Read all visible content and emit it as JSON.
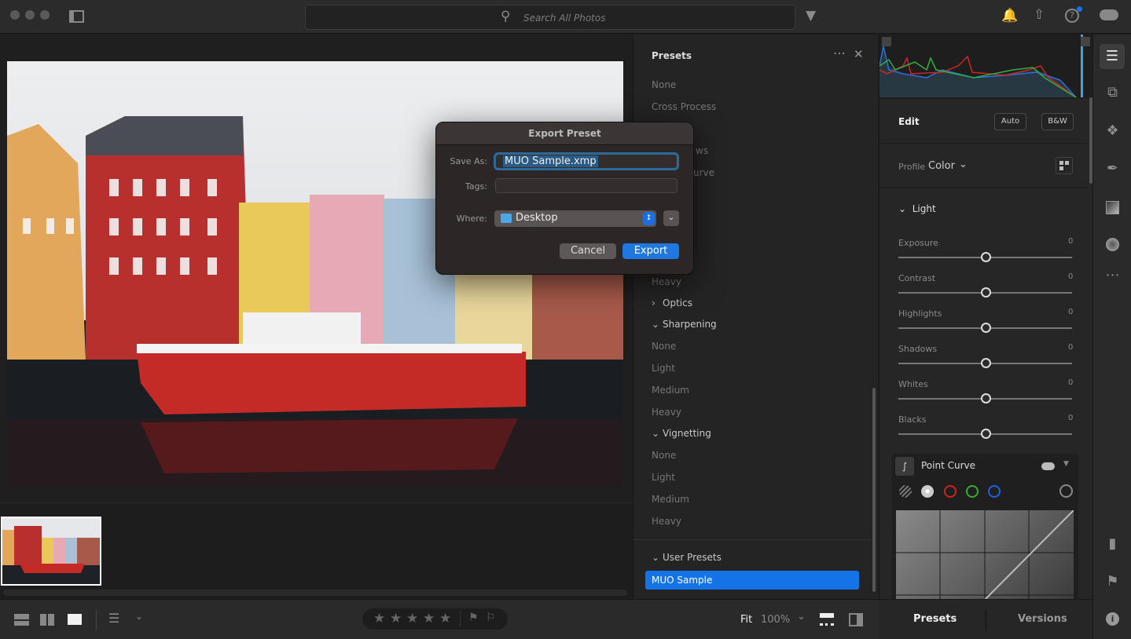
{
  "titlebar": {
    "search_placeholder": "Search All Photos",
    "icons": [
      "window-dot",
      "sidebar-toggle-icon",
      "search-icon",
      "filter-icon",
      "bell-icon",
      "share-icon",
      "help-icon",
      "cloud-icon"
    ],
    "notification_color": "#1473e6"
  },
  "presets": {
    "title": "Presets",
    "top_items": [
      "None",
      "Cross Process"
    ],
    "partial_items": [
      "ws",
      "urve"
    ],
    "heavy_above": "Heavy",
    "sections": [
      {
        "label": "Optics",
        "expanded": false,
        "items": []
      },
      {
        "label": "Sharpening",
        "expanded": true,
        "items": [
          "None",
          "Light",
          "Medium",
          "Heavy"
        ]
      },
      {
        "label": "Vignetting",
        "expanded": true,
        "items": [
          "None",
          "Light",
          "Medium",
          "Heavy"
        ]
      }
    ],
    "user_presets": {
      "label": "User Presets",
      "items": [
        "MUO Sample"
      ],
      "selected": "MUO Sample"
    }
  },
  "edit": {
    "title": "Edit",
    "auto_label": "Auto",
    "bw_label": "B&W",
    "profile_label": "Profile",
    "profile_value": "Color",
    "light_label": "Light",
    "sliders": [
      {
        "label": "Exposure",
        "value": "0"
      },
      {
        "label": "Contrast",
        "value": "0"
      },
      {
        "label": "Highlights",
        "value": "0"
      },
      {
        "label": "Shadows",
        "value": "0"
      },
      {
        "label": "Whites",
        "value": "0"
      },
      {
        "label": "Blacks",
        "value": "0"
      }
    ],
    "point_curve_label": "Point Curve",
    "channel_colors": [
      "#d0d0d0",
      "#d02020",
      "#30b030",
      "#2060e0"
    ]
  },
  "tabs": {
    "presets": "Presets",
    "versions": "Versions"
  },
  "bottombar": {
    "fit": "Fit",
    "zoom": "100%",
    "stars": 5
  },
  "dialog": {
    "title": "Export Preset",
    "save_as_label": "Save As:",
    "save_as_value": "MUO Sample.xmp",
    "tags_label": "Tags:",
    "tags_value": "",
    "where_label": "Where:",
    "where_value": "Desktop",
    "cancel": "Cancel",
    "export": "Export"
  }
}
